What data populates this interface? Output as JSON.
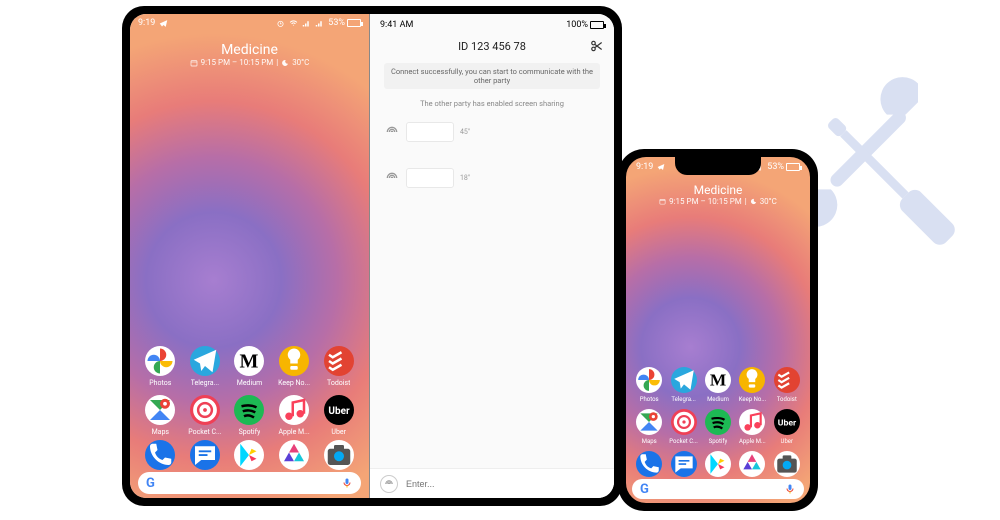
{
  "android": {
    "status": {
      "time": "9:19",
      "battery": "53%"
    },
    "widget": {
      "title": "Medicine",
      "time_range": "9:15 PM – 10:15 PM",
      "temp": "30°C"
    },
    "apps": [
      {
        "name": "photos",
        "label": "Photos",
        "bg": "#ffffff"
      },
      {
        "name": "telegram",
        "label": "Telegra...",
        "bg": "#2aa7de"
      },
      {
        "name": "medium",
        "label": "Medium",
        "bg": "#ffffff"
      },
      {
        "name": "keep",
        "label": "Keep No...",
        "bg": "#f7b500"
      },
      {
        "name": "todoist",
        "label": "Todoist",
        "bg": "#e24332"
      },
      {
        "name": "maps",
        "label": "Maps",
        "bg": "#ffffff"
      },
      {
        "name": "pocket",
        "label": "Pocket C...",
        "bg": "#ef4056"
      },
      {
        "name": "spotify",
        "label": "Spotify",
        "bg": "#1db954"
      },
      {
        "name": "applemusic",
        "label": "Apple M...",
        "bg": "#ffffff"
      },
      {
        "name": "uber",
        "label": "Uber",
        "bg": "#000000"
      }
    ],
    "dock": [
      {
        "name": "phone",
        "bg": "#1a73e8"
      },
      {
        "name": "messages",
        "bg": "#1a73e8"
      },
      {
        "name": "play",
        "bg": "#ffffff"
      },
      {
        "name": "gallery",
        "bg": "#ffffff"
      },
      {
        "name": "camera",
        "bg": "#ffffff"
      }
    ],
    "search": {
      "logo": "G"
    }
  },
  "chat": {
    "status": {
      "time": "9:41 AM",
      "battery": "100%"
    },
    "id": "ID 123 456 78",
    "banner": "Connect successfully, you can start to communicate with the other party",
    "info": "The other party has enabled screen sharing",
    "messages": [
      {
        "ts": "45''"
      },
      {
        "ts": "18''"
      }
    ],
    "input_placeholder": "Enter..."
  }
}
